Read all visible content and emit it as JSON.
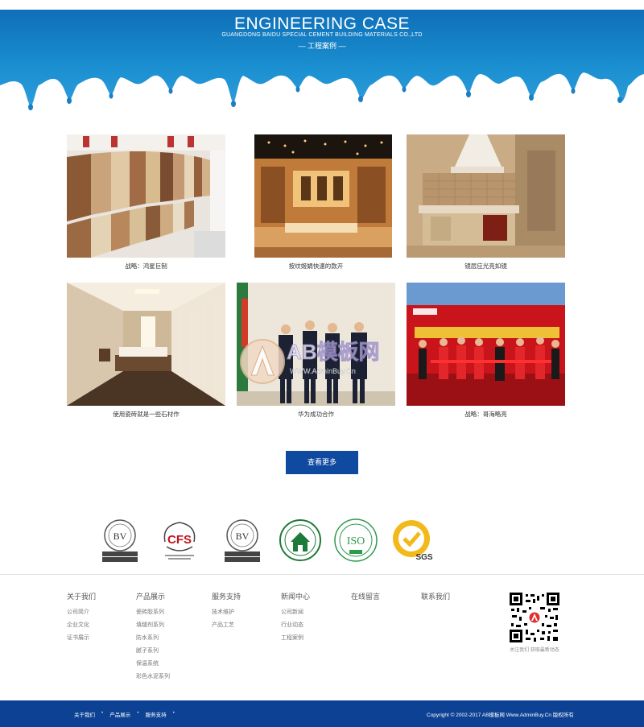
{
  "banner": {
    "title": "ENGINEERING CASE",
    "subtitle": "GUANGDONG BAIDU SPECIAL CEMENT BUILDING MATERIALS CO.,LTD",
    "cn_title": "— 工程案例 —"
  },
  "cases": [
    {
      "caption": "战略：鸿星巨制",
      "image": "tile-showroom"
    },
    {
      "caption": "按纹姬娟快速的款开",
      "image": "store-interior"
    },
    {
      "caption": "镜层应光亮如镜",
      "image": "kitchen-tiles"
    },
    {
      "caption": "使用瓷砖就是一些石材作",
      "image": "bedroom-corridor"
    },
    {
      "caption": "华为成功合作",
      "image": "business-meeting"
    },
    {
      "caption": "战略：哥海略亮",
      "image": "opening-ceremony"
    }
  ],
  "more_button": "查看更多",
  "watermark": {
    "text": "AB模板网",
    "url": "WWW.AdminBuy.Cn"
  },
  "certificates": [
    "bureau-veritas-badge",
    "cfs-badge",
    "bureau-veritas-badge",
    "green-building-badge",
    "iso-badge",
    "sgs-badge"
  ],
  "footer": {
    "columns": [
      {
        "heading": "关于我们",
        "links": [
          "公司简介",
          "企业文化",
          "证书展示"
        ]
      },
      {
        "heading": "产品展示",
        "links": [
          "瓷砖胶系列",
          "填缝剂系列",
          "防水系列",
          "腻子系列",
          "保温系统",
          "彩色水泥系列"
        ]
      },
      {
        "heading": "服务支持",
        "links": [
          "技术维护",
          "产品工艺"
        ]
      },
      {
        "heading": "新闻中心",
        "links": [
          "公司新闻",
          "行业动态",
          "工程案例"
        ]
      },
      {
        "heading": "在线留言",
        "links": []
      },
      {
        "heading": "联系我们",
        "links": []
      }
    ],
    "qr_caption": "关注我们 获取最新动态"
  },
  "bottom_bar": {
    "nav": [
      "关于我们",
      "产品展示",
      "服务支持"
    ],
    "separator": "•",
    "copyright": "Copyright © 2002-2017 AB模板网 Www.AdminBuy.Cn 版权所有"
  },
  "colors": {
    "banner": "#1a8fd0",
    "accent": "#1049a0",
    "bottom_bar": "#0d4193"
  }
}
